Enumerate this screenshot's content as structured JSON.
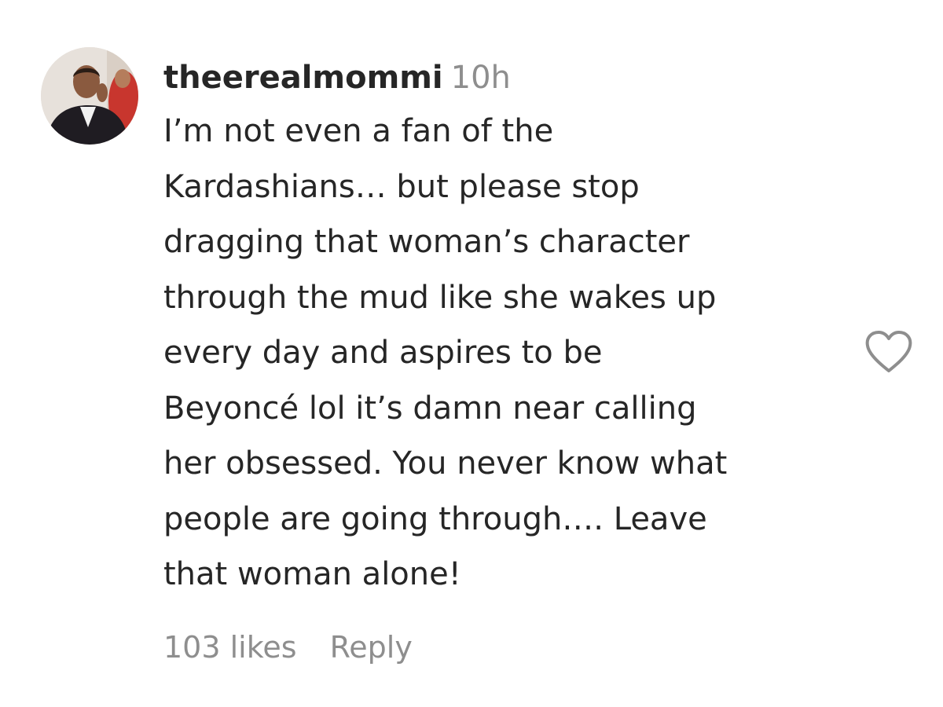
{
  "comment": {
    "username": "theerealmommi",
    "time": "10h",
    "text": "I’m not even a fan of the\nKardashians… but please stop\ndragging that woman’s character\nthrough the mud like she wakes up\nevery day and aspires to be\nBeyoncé lol it’s damn near calling\nher obsessed. You never know what\npeople are going through…. Leave\nthat woman alone!",
    "likes_label": "103 likes",
    "reply_label": "Reply"
  },
  "icons": {
    "avatar": "profile-photo",
    "like": "heart-outline-icon"
  },
  "colors": {
    "text": "#262626",
    "secondary": "#8e8e8e",
    "icon": "#8e8e8e"
  }
}
